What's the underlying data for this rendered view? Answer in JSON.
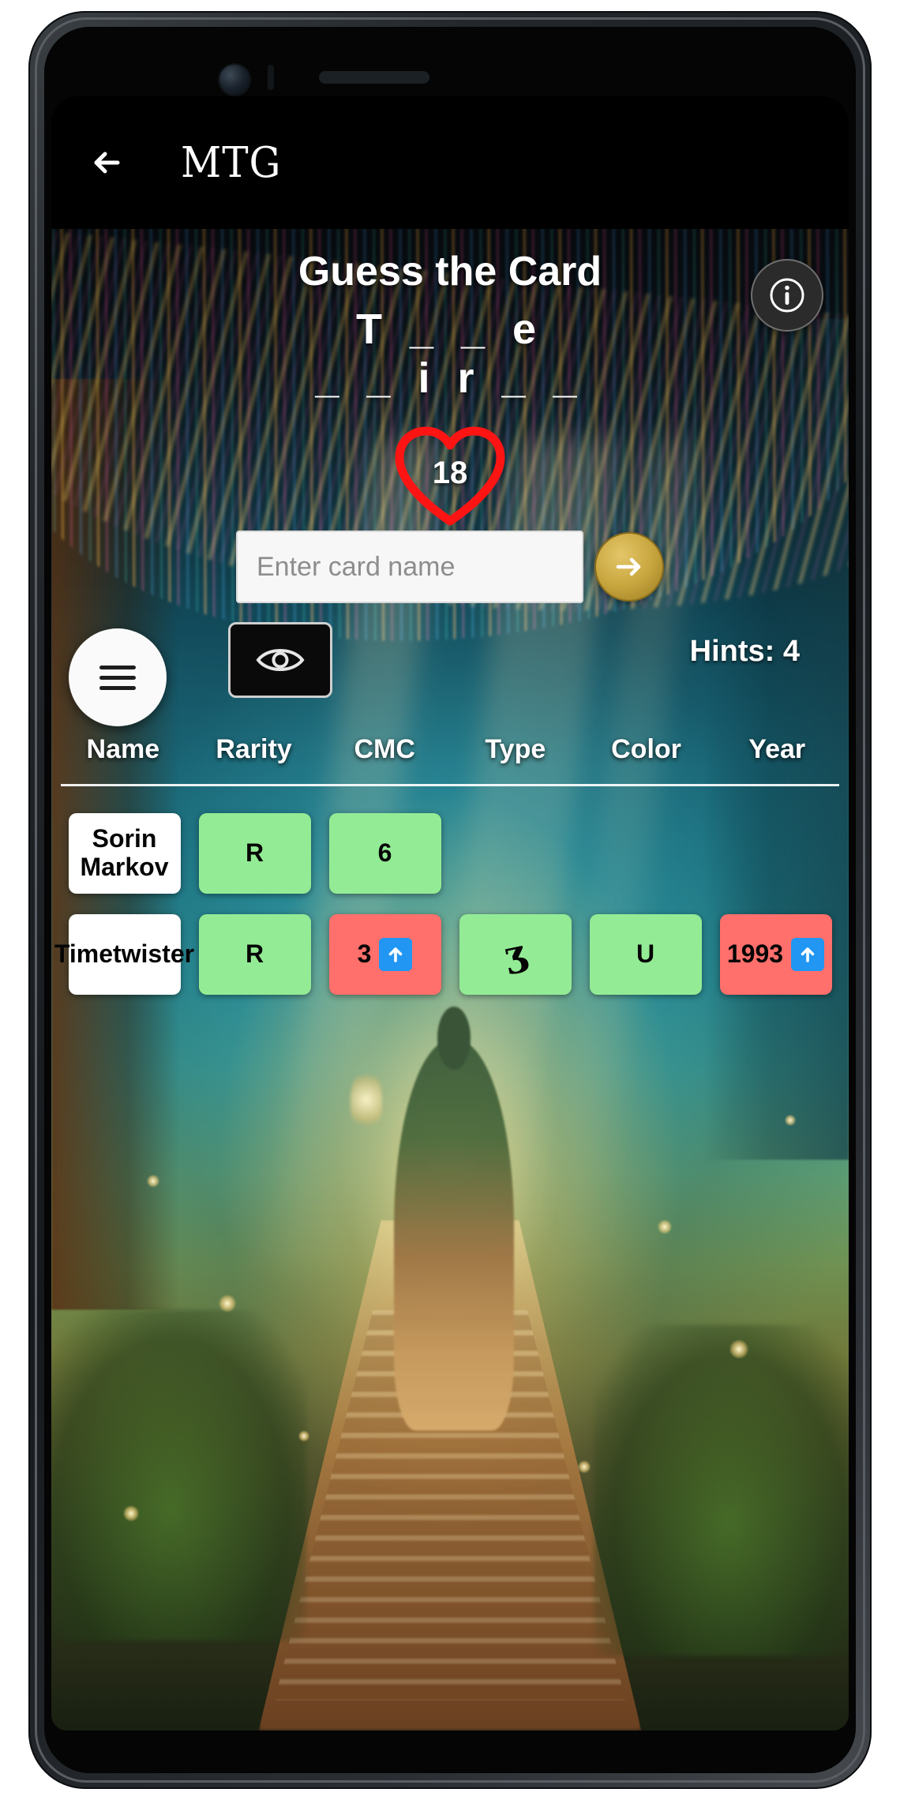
{
  "appbar": {
    "back_icon": "back-arrow-icon",
    "brand": "MTG"
  },
  "game": {
    "title": "Guess the Card",
    "info_icon": "info-icon",
    "puzzle_line1": "T _ _ e",
    "puzzle_line2": "_ _ i r _ _",
    "hearts_icon": "heart-icon",
    "hearts_count": "18",
    "input_placeholder": "Enter card name",
    "input_value": "",
    "submit_icon": "arrow-right-icon",
    "reveal_icon": "eye-icon",
    "hints_label": "Hints: 4",
    "menu_icon": "hamburger-menu-icon"
  },
  "colors": {
    "correct": "#93ec95",
    "incorrect": "#ff6f6b",
    "neutral": "#ffffff",
    "accent_gold": "#c9a73f",
    "heart_red": "#ff1414",
    "arrow_blue": "#2196f3"
  },
  "table": {
    "headers": [
      "Name",
      "Rarity",
      "CMC",
      "Type",
      "Color",
      "Year"
    ],
    "rows": [
      {
        "cells": [
          {
            "text": "Sorin Markov",
            "state": "name",
            "arrow": ""
          },
          {
            "text": "R",
            "state": "hit",
            "arrow": ""
          },
          {
            "text": "6",
            "state": "hit",
            "arrow": ""
          },
          {
            "text": "",
            "state": "empty",
            "arrow": ""
          },
          {
            "text": "",
            "state": "empty",
            "arrow": ""
          },
          {
            "text": "",
            "state": "empty",
            "arrow": ""
          }
        ]
      },
      {
        "cells": [
          {
            "text": "Timetwister",
            "state": "name",
            "arrow": ""
          },
          {
            "text": "R",
            "state": "hit",
            "arrow": ""
          },
          {
            "text": "3",
            "state": "miss",
            "arrow": "up"
          },
          {
            "text": "ʒ",
            "state": "hit",
            "arrow": ""
          },
          {
            "text": "U",
            "state": "hit",
            "arrow": ""
          },
          {
            "text": "1993",
            "state": "miss",
            "arrow": "up"
          }
        ]
      }
    ]
  }
}
